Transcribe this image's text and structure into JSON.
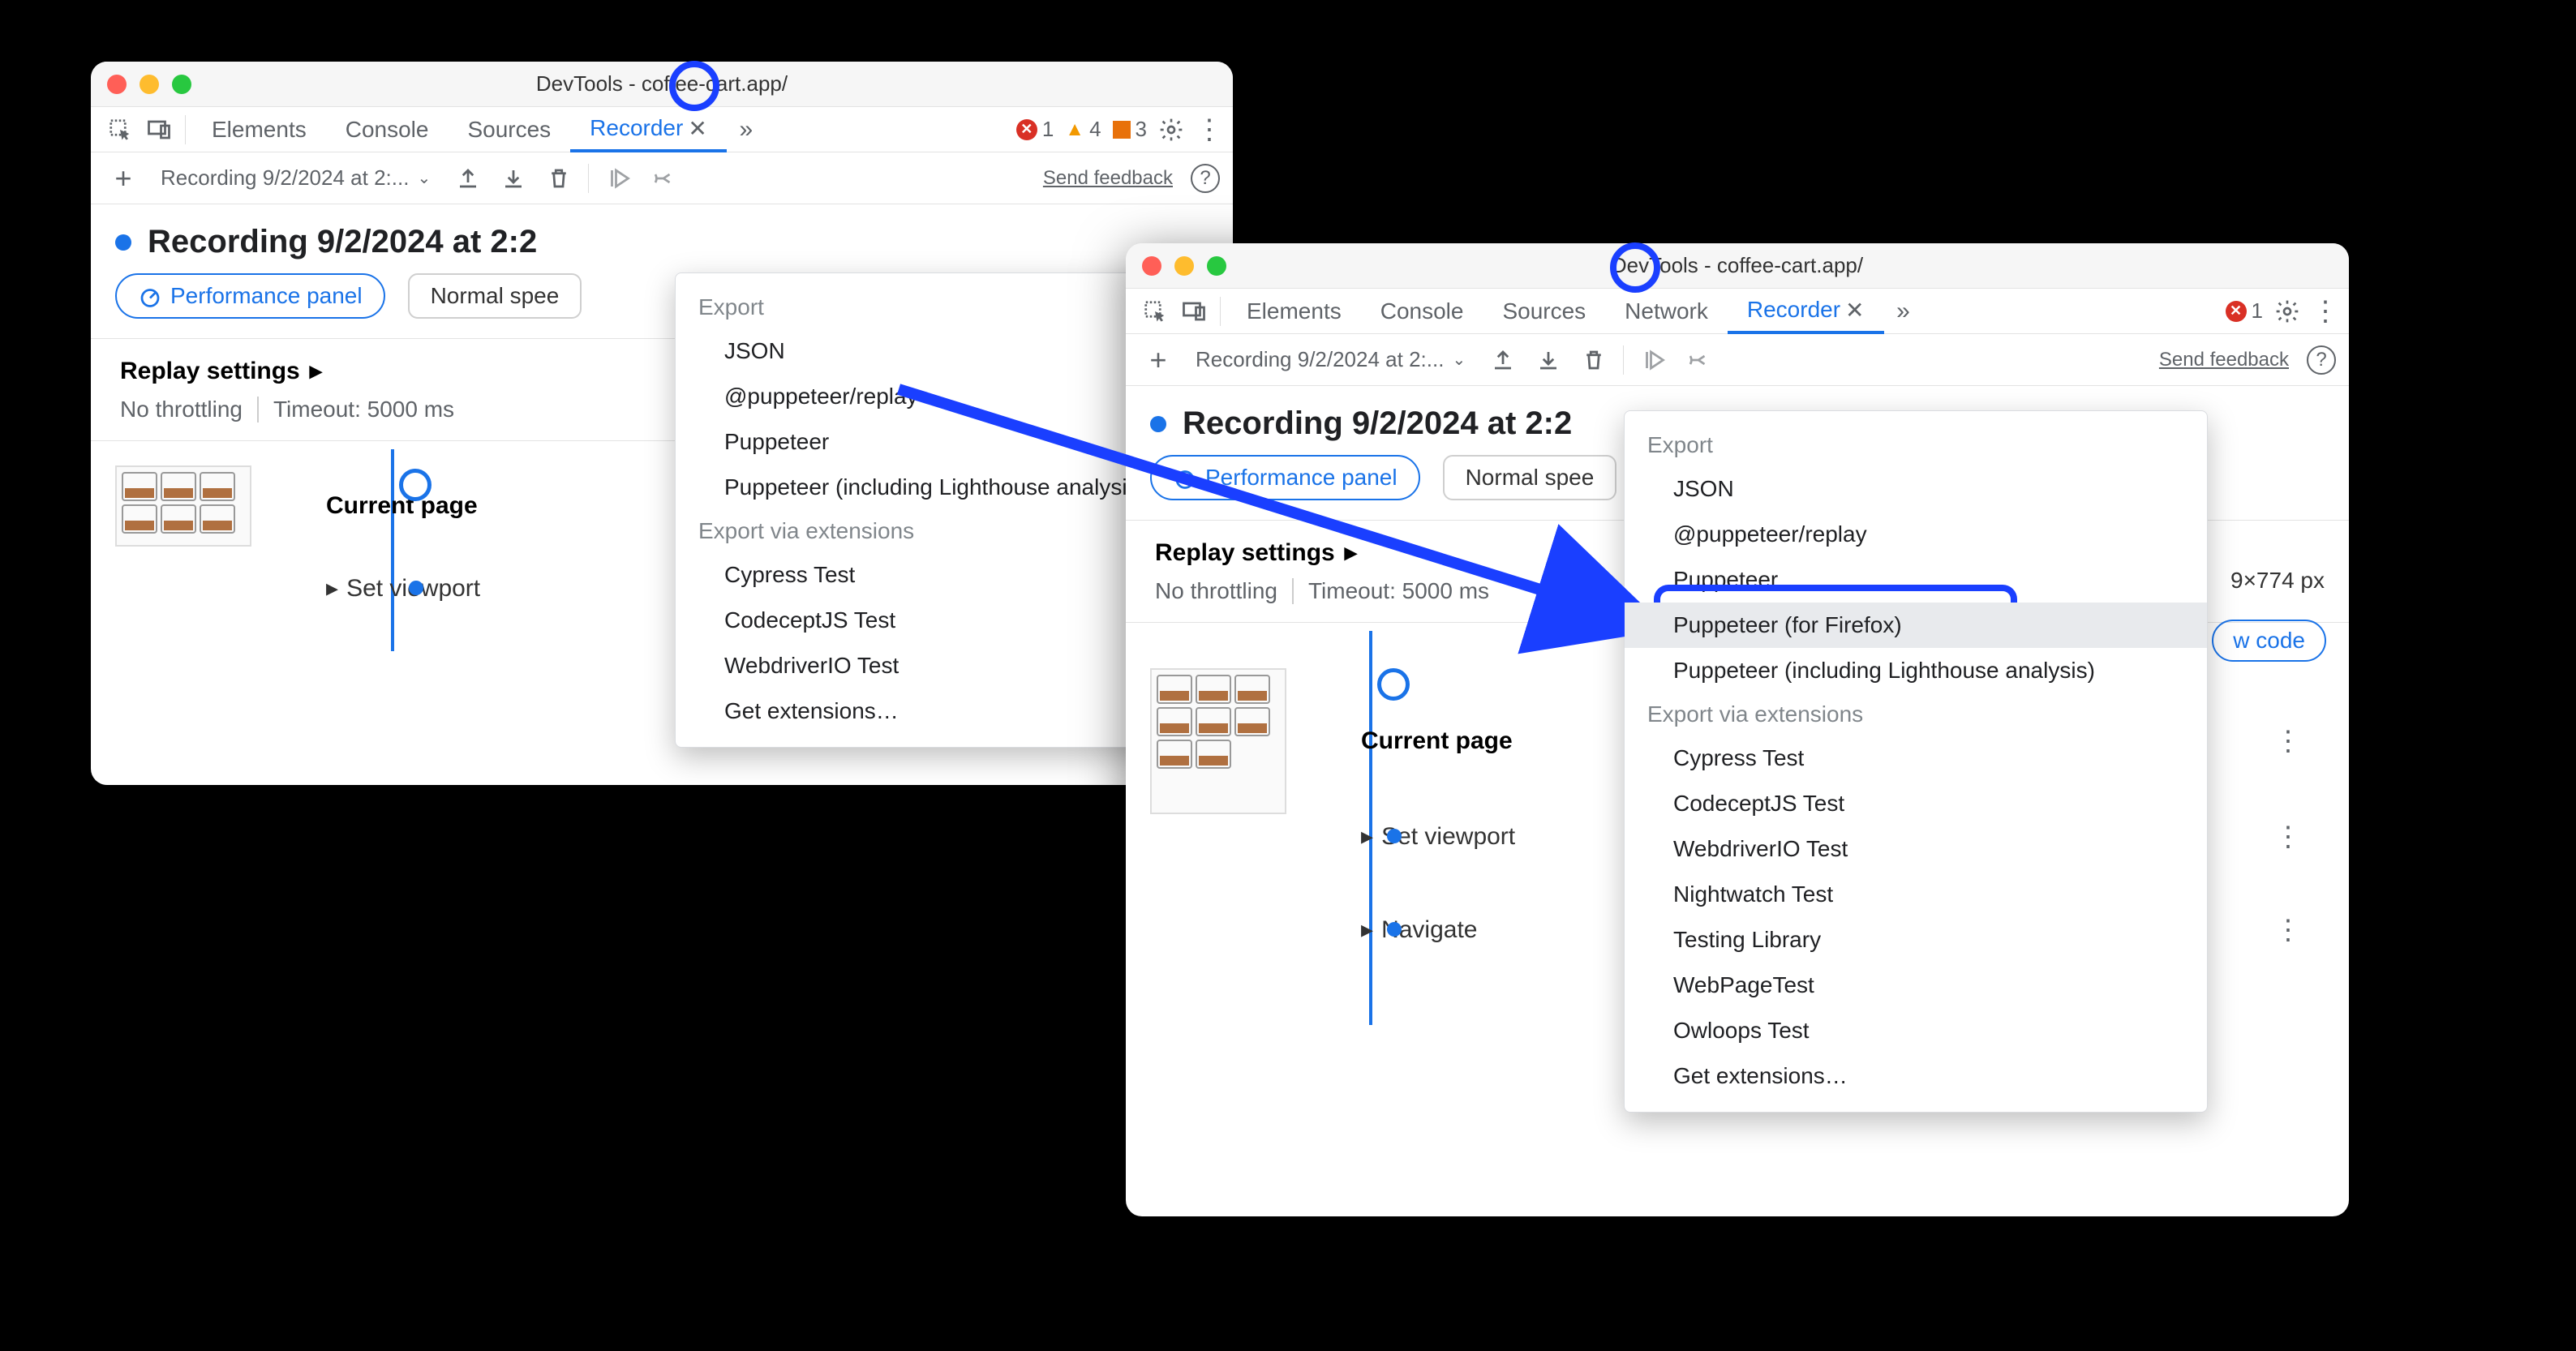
{
  "window_title": "DevTools - coffee-cart.app/",
  "tabs": {
    "elements": "Elements",
    "console": "Console",
    "sources": "Sources",
    "network": "Network",
    "recorder": "Recorder"
  },
  "counts": {
    "errors1": "1",
    "warnings1": "4",
    "issues1": "3",
    "errors2": "1"
  },
  "toolbar": {
    "recording_select": "Recording 9/2/2024 at 2:...",
    "recording_select2": "Recording 9/2/2024 at 2:...",
    "feedback": "Send feedback"
  },
  "recording": {
    "title": "Recording 9/2/2024 at 2:2",
    "perf_button": "Performance panel",
    "speed": "Normal spee",
    "speed2": "Normal spee"
  },
  "settings": {
    "header": "Replay settings",
    "throttling": "No throttling",
    "timeout": "Timeout: 5000 ms"
  },
  "steps": {
    "current": "Current page",
    "viewport": "Set viewport",
    "navigate": "Navigate",
    "dimension": "9×774 px",
    "show_code": "w code"
  },
  "export_a": {
    "header": "Export",
    "items": [
      "JSON",
      "@puppeteer/replay",
      "Puppeteer",
      "Puppeteer (including Lighthouse analysis)"
    ],
    "ext_header": "Export via extensions",
    "ext_items": [
      "Cypress Test",
      "CodeceptJS Test",
      "WebdriverIO Test",
      "Get extensions…"
    ]
  },
  "export_b": {
    "header": "Export",
    "items": [
      "JSON",
      "@puppeteer/replay",
      "Puppeteer",
      "Puppeteer (for Firefox)",
      "Puppeteer (including Lighthouse analysis)"
    ],
    "ext_header": "Export via extensions",
    "ext_items": [
      "Cypress Test",
      "CodeceptJS Test",
      "WebdriverIO Test",
      "Nightwatch Test",
      "Testing Library",
      "WebPageTest",
      "Owloops Test",
      "Get extensions…"
    ],
    "highlight_index": 3
  }
}
